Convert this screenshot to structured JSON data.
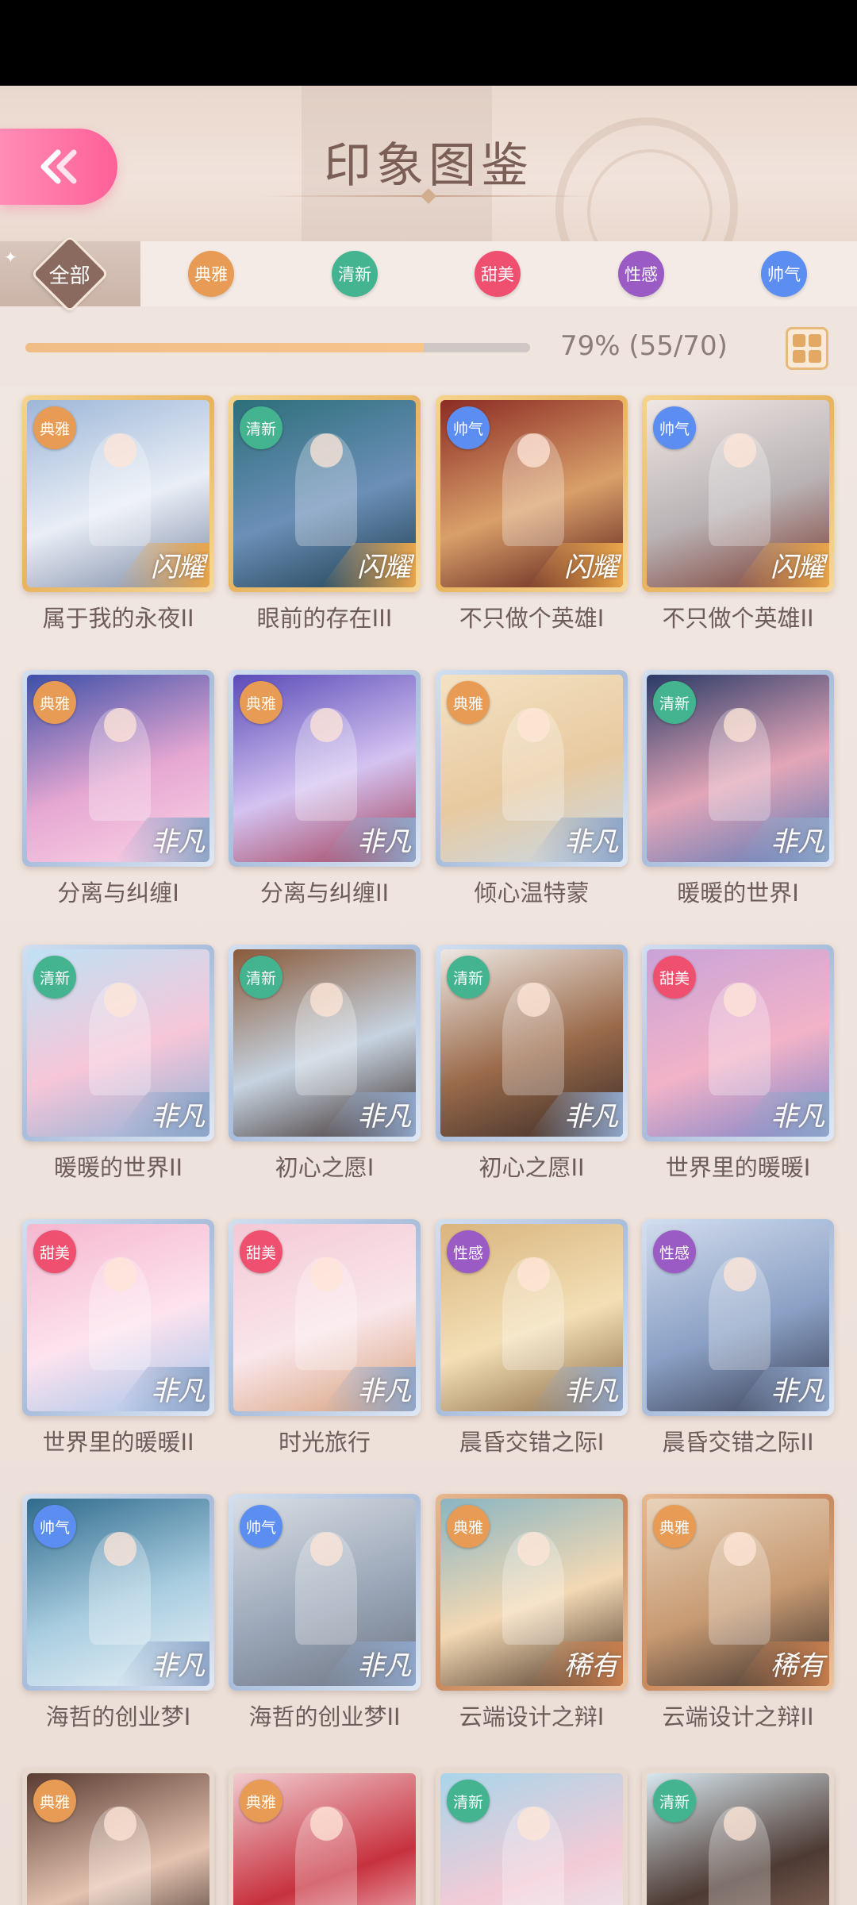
{
  "header": {
    "title": "印象图鉴"
  },
  "filters": [
    {
      "label": "全部",
      "color": "#8a6a5e",
      "active": true
    },
    {
      "label": "典雅",
      "color": "#e79b54",
      "active": false
    },
    {
      "label": "清新",
      "color": "#43b48f",
      "active": false
    },
    {
      "label": "甜美",
      "color": "#f0506f",
      "active": false
    },
    {
      "label": "性感",
      "color": "#9a5bc4",
      "active": false
    },
    {
      "label": "帅气",
      "color": "#5c8ef2",
      "active": false
    }
  ],
  "progress": {
    "text": "79% (55/70)",
    "fraction": 0.79
  },
  "tag_colors": {
    "典雅": "#e79b54",
    "清新": "#43b48f",
    "甜美": "#f0506f",
    "性感": "#9a5bc4",
    "帅气": "#5c8ef2"
  },
  "rarity_styles": {
    "闪耀": {
      "frame": "gold",
      "band": "#e9a54a"
    },
    "非凡": {
      "frame": "blue",
      "band": "#8fa6c9"
    },
    "稀有": {
      "frame": "copper",
      "band": "#c57d4d"
    }
  },
  "cards": [
    {
      "name": "属于我的永夜II",
      "tag": "典雅",
      "rarity": "闪耀",
      "art": [
        "#9db7d8",
        "#e9eef6",
        "#7c8aa6"
      ]
    },
    {
      "name": "眼前的存在III",
      "tag": "清新",
      "rarity": "闪耀",
      "art": [
        "#2c6f7a",
        "#6c8fb8",
        "#1d3e4e"
      ]
    },
    {
      "name": "不只做个英雄I",
      "tag": "帅气",
      "rarity": "闪耀",
      "art": [
        "#8c2b24",
        "#d9a06a",
        "#5a1c18"
      ]
    },
    {
      "name": "不只做个英雄II",
      "tag": "帅气",
      "rarity": "闪耀",
      "art": [
        "#efe7e4",
        "#b9b2b4",
        "#7a3a30"
      ]
    },
    {
      "name": "分离与纠缠I",
      "tag": "典雅",
      "rarity": "非凡",
      "art": [
        "#3d4fa8",
        "#e6a8d2",
        "#fbd3e6"
      ]
    },
    {
      "name": "分离与纠缠II",
      "tag": "典雅",
      "rarity": "非凡",
      "art": [
        "#5b4bb8",
        "#d4c3f1",
        "#a13b55"
      ]
    },
    {
      "name": "倾心温特蒙",
      "tag": "典雅",
      "rarity": "非凡",
      "art": [
        "#f4e2c4",
        "#e8caa0",
        "#c9d9e8"
      ]
    },
    {
      "name": "暖暖的世界I",
      "tag": "清新",
      "rarity": "非凡",
      "art": [
        "#2a3a66",
        "#e3a6b8",
        "#5e79b6"
      ]
    },
    {
      "name": "暖暖的世界II",
      "tag": "清新",
      "rarity": "非凡",
      "art": [
        "#bfe1f4",
        "#f6c6d8",
        "#8fb1d6"
      ]
    },
    {
      "name": "初心之愿I",
      "tag": "清新",
      "rarity": "非凡",
      "art": [
        "#8a5a3a",
        "#c6d3e0",
        "#3b2c2a"
      ]
    },
    {
      "name": "初心之愿II",
      "tag": "清新",
      "rarity": "非凡",
      "art": [
        "#ede7e2",
        "#9a6a4a",
        "#3a2c28"
      ]
    },
    {
      "name": "世界里的暖暖I",
      "tag": "甜美",
      "rarity": "非凡",
      "art": [
        "#c9a3d8",
        "#f2b3c8",
        "#7f84c8"
      ]
    },
    {
      "name": "世界里的暖暖II",
      "tag": "甜美",
      "rarity": "非凡",
      "art": [
        "#f5b7cf",
        "#fde3ee",
        "#a6c4ea"
      ]
    },
    {
      "name": "时光旅行",
      "tag": "甜美",
      "rarity": "非凡",
      "art": [
        "#f4c9d6",
        "#f9e6ea",
        "#d7a07a"
      ]
    },
    {
      "name": "晨昏交错之际I",
      "tag": "性感",
      "rarity": "非凡",
      "art": [
        "#d9b57e",
        "#f3dfb6",
        "#8a6a46"
      ]
    },
    {
      "name": "晨昏交错之际II",
      "tag": "性感",
      "rarity": "非凡",
      "art": [
        "#cfd9ec",
        "#8aa0c4",
        "#3a3f55"
      ]
    },
    {
      "name": "海哲的创业梦I",
      "tag": "帅气",
      "rarity": "非凡",
      "art": [
        "#2f6b8c",
        "#a9cde0",
        "#e9f2f7"
      ]
    },
    {
      "name": "海哲的创业梦II",
      "tag": "帅气",
      "rarity": "非凡",
      "art": [
        "#d8dde4",
        "#9ba7b8",
        "#6e7684"
      ]
    },
    {
      "name": "云端设计之辩I",
      "tag": "典雅",
      "rarity": "稀有",
      "art": [
        "#8ab5c2",
        "#f3d9b4",
        "#4b3527"
      ]
    },
    {
      "name": "云端设计之辩II",
      "tag": "典雅",
      "rarity": "稀有",
      "art": [
        "#e8d3bb",
        "#c79a72",
        "#3c302c"
      ]
    },
    {
      "name": "",
      "tag": "典雅",
      "rarity": "",
      "art": [
        "#5a3b32",
        "#e4c3b0",
        "#2b1d19"
      ]
    },
    {
      "name": "",
      "tag": "典雅",
      "rarity": "",
      "art": [
        "#f1ccd0",
        "#c7313e",
        "#ffe6ea"
      ]
    },
    {
      "name": "",
      "tag": "清新",
      "rarity": "",
      "art": [
        "#a9d5ea",
        "#f2cbd6",
        "#e8f2f8"
      ]
    },
    {
      "name": "",
      "tag": "清新",
      "rarity": "",
      "art": [
        "#d7e6ee",
        "#4d3a33",
        "#9c7b6a"
      ]
    }
  ]
}
